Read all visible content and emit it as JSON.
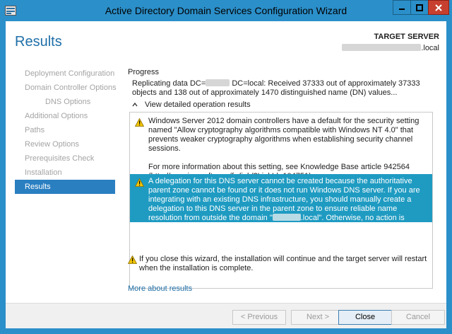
{
  "window": {
    "title": "Active Directory Domain Services Configuration Wizard"
  },
  "header": {
    "page_title": "Results",
    "target_server_label": "TARGET SERVER",
    "target_server_suffix": ".local"
  },
  "sidebar": {
    "items": [
      {
        "label": "Deployment Configuration",
        "state": "disabled"
      },
      {
        "label": "Domain Controller Options",
        "state": "disabled"
      },
      {
        "label": "DNS Options",
        "state": "disabled"
      },
      {
        "label": "Additional Options",
        "state": "disabled"
      },
      {
        "label": "Paths",
        "state": "disabled"
      },
      {
        "label": "Review Options",
        "state": "disabled"
      },
      {
        "label": "Prerequisites Check",
        "state": "disabled"
      },
      {
        "label": "Installation",
        "state": "disabled"
      },
      {
        "label": "Results",
        "state": "active"
      }
    ]
  },
  "progress": {
    "label": "Progress",
    "text_prefix": "Replicating data DC=",
    "text_rest": "DC=local: Received 37333 out of approximately 37333 objects and 138 out of approximately 1470 distinguished name (DN) values..."
  },
  "details": {
    "toggle_label": "View detailed operation results",
    "messages": {
      "crypto_p1": "Windows Server 2012 domain controllers have a default for the security setting named \"Allow cryptography algorithms compatible with Windows NT 4.0\" that prevents weaker cryptography algorithms when establishing security channel sessions.",
      "crypto_p2": "For more information about this setting, see Knowledge Base article 942564 (http://go.microsoft.com/fwlink/?LinkId=104751).",
      "dns_delegation_main": "A delegation for this DNS server cannot be created because the authoritative parent zone cannot be found or it does not run Windows DNS server. If you are integrating with an existing DNS infrastructure, you should manually create a delegation to this DNS server in the parent zone to ensure reliable name resolution from outside the domain \"",
      "dns_delegation_tail": ".local\". Otherwise, no action is required."
    }
  },
  "close_note": "If you close this wizard, the installation will continue and the target server will restart when the installation is complete.",
  "more_link": "More about results",
  "footer": {
    "previous": "< Previous",
    "next": "Next >",
    "close": "Close",
    "cancel": "Cancel"
  },
  "colors": {
    "titlebar": "#2b8fc9",
    "accent": "#1f6fa8",
    "selection": "#2a7fc1",
    "highlight_row": "#1f9bc2",
    "close_button": "#c7402f",
    "warning": "#f2c500"
  },
  "icons": {
    "app": "server-manager-icon",
    "warning": "warning-icon",
    "toggle": "chevron-up-icon"
  }
}
